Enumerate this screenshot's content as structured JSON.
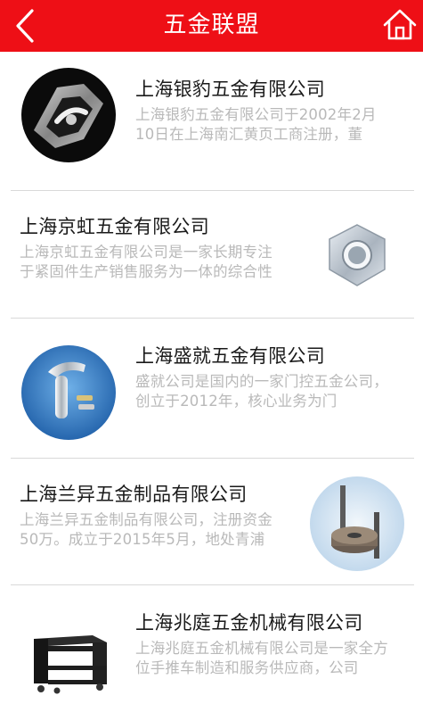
{
  "header": {
    "title": "五金联盟",
    "back_icon": "chevron-left-icon",
    "home_icon": "home-icon"
  },
  "colors": {
    "header_bg": "#ee0f16",
    "title": "#1a1a1a",
    "desc": "#b9b9b9"
  },
  "companies": [
    {
      "name": "上海银豹五金有限公司",
      "desc": "上海银豹五金有限公司于2002年2月10日在上海南汇黄页工商注册，董",
      "image": "chrome-handle-photo"
    },
    {
      "name": "上海京虹五金有限公司",
      "desc": "上海京虹五金有限公司是一家长期专注于紧固件生产销售服务为一体的综合性",
      "image": "hex-nut-photo"
    },
    {
      "name": "上海盛就五金有限公司",
      "desc": "盛就公司是国内的一家门控五金公司，创立于2012年，核心业务为门",
      "image": "door-lock-handle-photo"
    },
    {
      "name": "上海兰异五金制品有限公司",
      "desc": "上海兰异五金制品有限公司，注册资金50万。成立于2015年5月，地处青浦城",
      "image": "gear-shaft-photo"
    },
    {
      "name": "上海兆庭五金机械有限公司",
      "desc": "上海兆庭五金机械有限公司是一家全方位手推车制造和服务供应商，公司",
      "image": "trolley-cart-photo"
    }
  ]
}
